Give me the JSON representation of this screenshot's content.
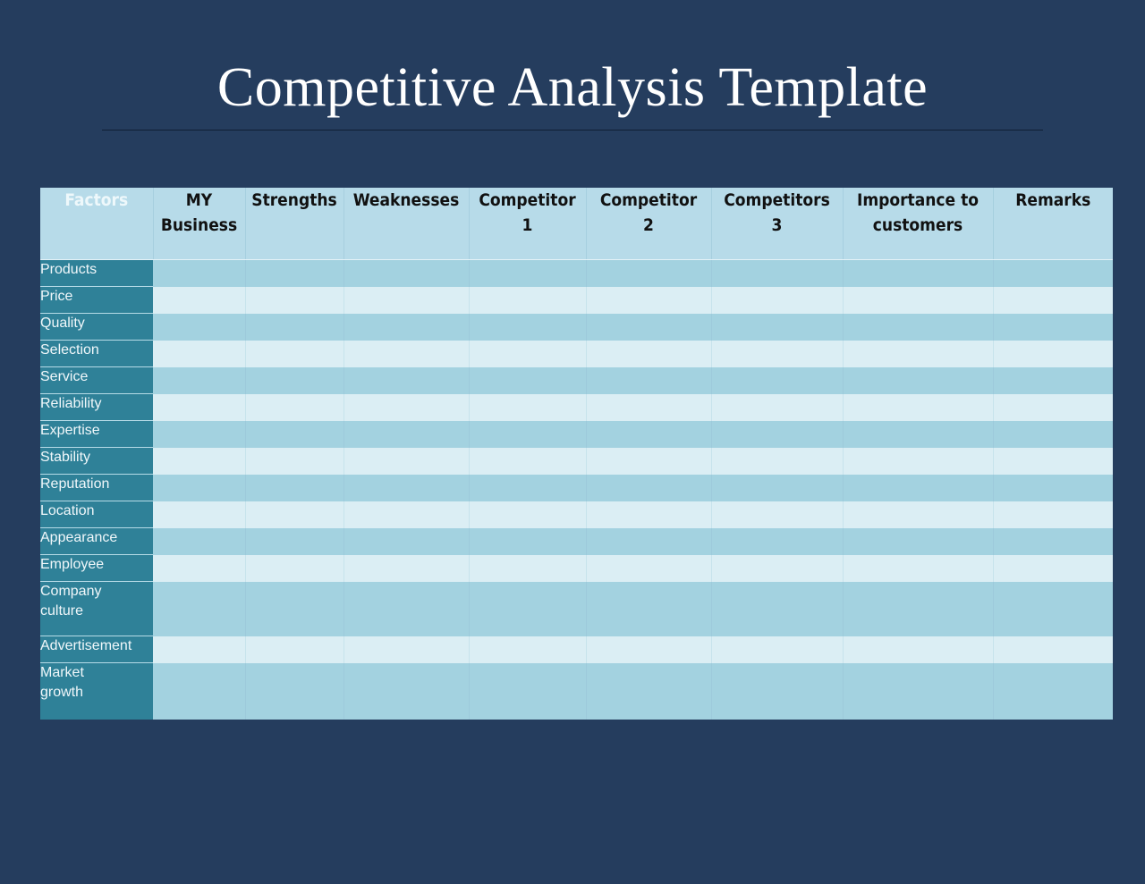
{
  "title": "Competitive Analysis Template",
  "table": {
    "headers": [
      "Factors",
      "MY Business",
      "Strengths",
      "Weaknesses",
      "Competitor 1",
      "Competitor 2",
      "Competitors 3",
      "Importance to customers",
      "Remarks"
    ],
    "header_lines": [
      [
        "Factors"
      ],
      [
        "MY",
        "Business"
      ],
      [
        "Strengths"
      ],
      [
        "Weaknesses"
      ],
      [
        "Competitor",
        "1"
      ],
      [
        "Competitor",
        "2"
      ],
      [
        "Competitors",
        "3"
      ],
      [
        "Importance to",
        "customers"
      ],
      [
        "Remarks"
      ]
    ],
    "rows": [
      {
        "factor": "Products",
        "values": [
          "",
          "",
          "",
          "",
          "",
          "",
          "",
          ""
        ]
      },
      {
        "factor": "Price",
        "values": [
          "",
          "",
          "",
          "",
          "",
          "",
          "",
          ""
        ]
      },
      {
        "factor": "Quality",
        "values": [
          "",
          "",
          "",
          "",
          "",
          "",
          "",
          ""
        ]
      },
      {
        "factor": "Selection",
        "values": [
          "",
          "",
          "",
          "",
          "",
          "",
          "",
          ""
        ]
      },
      {
        "factor": "Service",
        "values": [
          "",
          "",
          "",
          "",
          "",
          "",
          "",
          ""
        ]
      },
      {
        "factor": "Reliability",
        "values": [
          "",
          "",
          "",
          "",
          "",
          "",
          "",
          ""
        ]
      },
      {
        "factor": "Expertise",
        "values": [
          "",
          "",
          "",
          "",
          "",
          "",
          "",
          ""
        ]
      },
      {
        "factor": "Stability",
        "values": [
          "",
          "",
          "",
          "",
          "",
          "",
          "",
          ""
        ]
      },
      {
        "factor": "Reputation",
        "values": [
          "",
          "",
          "",
          "",
          "",
          "",
          "",
          ""
        ]
      },
      {
        "factor": "Location",
        "values": [
          "",
          "",
          "",
          "",
          "",
          "",
          "",
          ""
        ]
      },
      {
        "factor": "Appearance",
        "values": [
          "",
          "",
          "",
          "",
          "",
          "",
          "",
          ""
        ]
      },
      {
        "factor": "Employee",
        "values": [
          "",
          "",
          "",
          "",
          "",
          "",
          "",
          ""
        ]
      },
      {
        "factor": "Company culture",
        "factor_lines": [
          "Company",
          "culture"
        ],
        "values": [
          "",
          "",
          "",
          "",
          "",
          "",
          "",
          ""
        ]
      },
      {
        "factor": "Advertisement",
        "values": [
          "",
          "",
          "",
          "",
          "",
          "",
          "",
          ""
        ]
      },
      {
        "factor": "Market growth",
        "factor_lines": [
          "Market",
          "growth"
        ],
        "values": [
          "",
          "",
          "",
          "",
          "",
          "",
          "",
          ""
        ]
      }
    ]
  },
  "colors": {
    "background": "#253d5e",
    "header_fill": "#b7dbe9",
    "factor_fill": "#2f8198",
    "band_dark": "#a3d2e0",
    "band_light": "#dbeef4"
  }
}
